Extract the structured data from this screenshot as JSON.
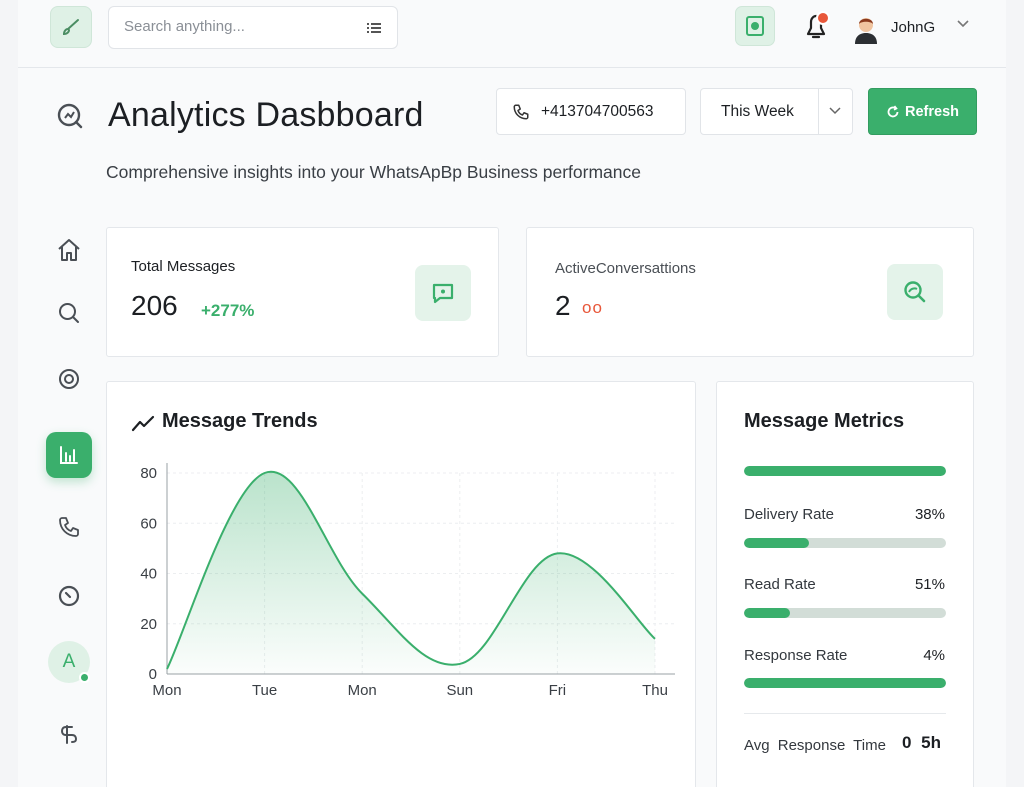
{
  "search": {
    "placeholder": "Search anything..."
  },
  "user": {
    "name": "JohnG"
  },
  "header": {
    "title": "Analytics Dasbboard",
    "subtitle": "Comprehensive insights into your WhatsApBp Business performance",
    "phone": "+413704700563",
    "period": "This Week",
    "refresh_label": "Refresh"
  },
  "stats": {
    "total_messages": {
      "label": "Total Messages",
      "value": "206",
      "change": "+277%"
    },
    "active_conversations": {
      "label": "ActiveConversattions",
      "value": "2",
      "indicator": "oo"
    }
  },
  "sidebar": {
    "items": [
      "home-icon",
      "search-icon",
      "radar-icon",
      "chart-icon",
      "phone-icon",
      "clock-icon",
      "avatar",
      "integrations-icon"
    ],
    "active_index": 3,
    "avatar_initial": "A"
  },
  "trends": {
    "title": "Message Trends"
  },
  "chart_data": {
    "type": "area",
    "title": "Message Trends",
    "categories": [
      "Mon",
      "Tue",
      "Mon",
      "Sun",
      "Fri",
      "Thu"
    ],
    "series": [
      {
        "values": [
          2,
          80,
          32,
          4,
          48,
          14
        ]
      }
    ],
    "ylim": [
      0,
      80
    ],
    "yticks": [
      "0",
      "20",
      "40",
      "60",
      "80"
    ],
    "grid": true,
    "color": "#3aaf6c"
  },
  "metrics": {
    "title": "Message Metrics",
    "top_bar_fraction": 1.0,
    "items": [
      {
        "label": "Delivery Rate",
        "value": "38%",
        "fraction": 0.32
      },
      {
        "label": "Read Rate",
        "value": "51%",
        "fraction": 0.23
      },
      {
        "label": "Response Rate",
        "value": "4%",
        "fraction": 1.0
      }
    ],
    "avg_label": "Avg Response Time",
    "avg_value": "0 5h"
  },
  "colors": {
    "accent": "#3aaf6c",
    "accent_light": "#dff1e6",
    "alert": "#e8573a"
  }
}
